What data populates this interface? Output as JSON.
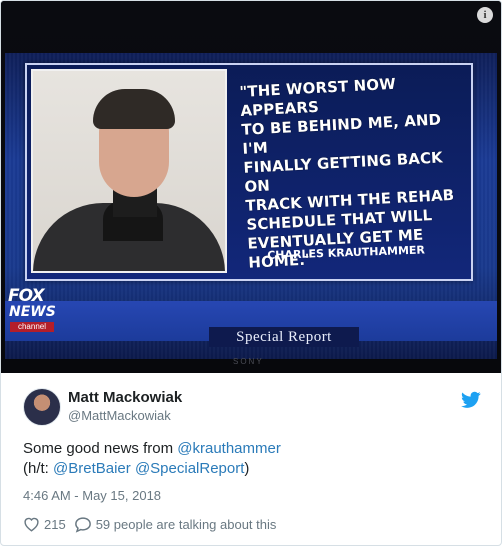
{
  "media": {
    "quote": "\"THE WORST NOW APPEARS TO BE BEHIND ME, AND I'M FINALLY GETTING BACK ON TRACK WITH THE REHAB SCHEDULE THAT WILL EVENTUALLY GET ME HOME.\"",
    "quote_lines": [
      "\"THE WORST NOW APPEARS",
      "TO BE BEHIND ME, AND I'M",
      "FINALLY GETTING BACK ON",
      "TRACK WITH THE REHAB",
      "SCHEDULE THAT WILL",
      "EVENTUALLY GET ME HOME.\""
    ],
    "attribution": "CHARLES KRAUTHAMMER",
    "show_title": "Special Report",
    "network_logo": {
      "line1": "FOX",
      "line2": "NEWS",
      "line3": "channel"
    },
    "tv_brand": "SONY",
    "info_icon": "info-icon"
  },
  "tweet": {
    "author_name": "Matt Mackowiak",
    "author_handle": "@MattMackowiak",
    "text_prefix": "Some good news from ",
    "mention_1": "@krauthammer",
    "line2_prefix": "(h/t: ",
    "mention_2": "@BretBaier",
    "mention_3": "@SpecialReport",
    "line2_suffix": ")",
    "timestamp": "4:46 AM - May 15, 2018",
    "likes": "215",
    "replies_text": "59 people are talking about this"
  },
  "colors": {
    "link": "#2b7bb9",
    "twitter_blue": "#1da1f2",
    "text": "#1c2022",
    "muted": "#697882"
  },
  "icons": [
    "info-icon",
    "twitter-bird-icon",
    "heart-icon",
    "comment-icon"
  ]
}
